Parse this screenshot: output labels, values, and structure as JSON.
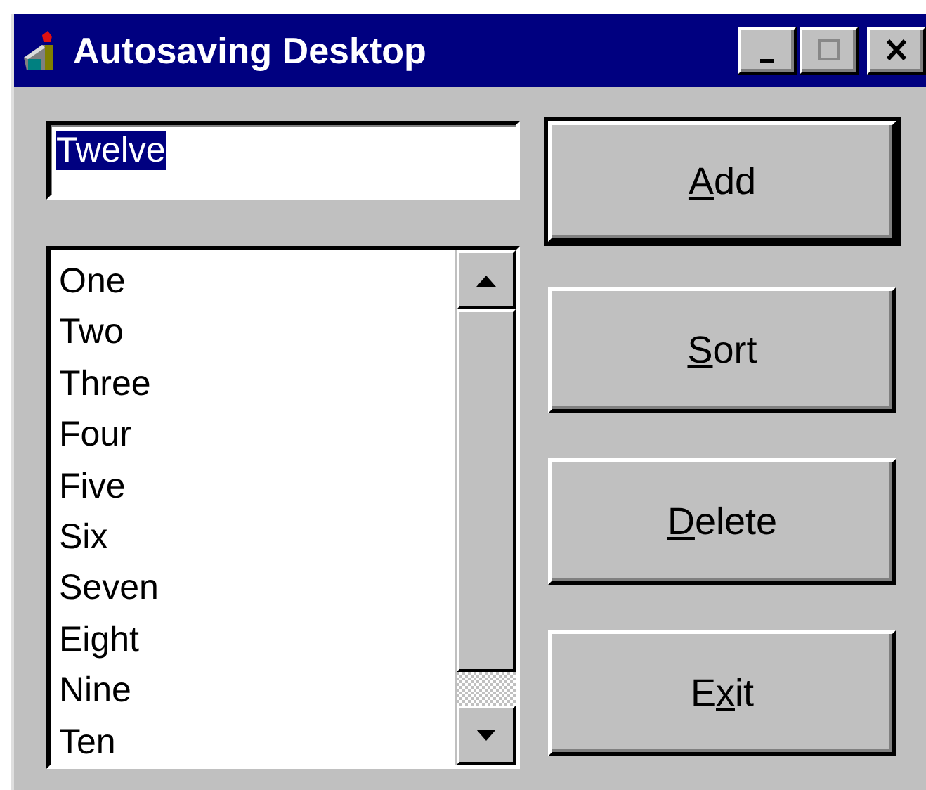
{
  "window": {
    "title": "Autosaving Desktop"
  },
  "entry": {
    "value": "Twelve",
    "selected": true
  },
  "list": {
    "items": [
      {
        "label": "One",
        "selected": false
      },
      {
        "label": "Two",
        "selected": false
      },
      {
        "label": "Three",
        "selected": false
      },
      {
        "label": "Four",
        "selected": false
      },
      {
        "label": "Five",
        "selected": false
      },
      {
        "label": "Six",
        "selected": false
      },
      {
        "label": "Seven",
        "selected": false
      },
      {
        "label": "Eight",
        "selected": false
      },
      {
        "label": "Nine",
        "selected": false
      },
      {
        "label": "Ten",
        "selected": false
      }
    ]
  },
  "buttons": [
    {
      "default": true,
      "label": [
        {
          "text": "A",
          "underlined": true
        },
        {
          "text": "dd",
          "underlined": false
        }
      ]
    },
    {
      "default": false,
      "label": [
        {
          "text": "S",
          "underlined": true
        },
        {
          "text": "ort",
          "underlined": false
        }
      ]
    },
    {
      "default": false,
      "label": [
        {
          "text": "D",
          "underlined": true
        },
        {
          "text": "elete",
          "underlined": false
        }
      ]
    },
    {
      "default": false,
      "label": [
        {
          "text": "E",
          "underlined": false
        },
        {
          "text": "x",
          "underlined": true
        },
        {
          "text": "it",
          "underlined": false
        }
      ]
    }
  ]
}
